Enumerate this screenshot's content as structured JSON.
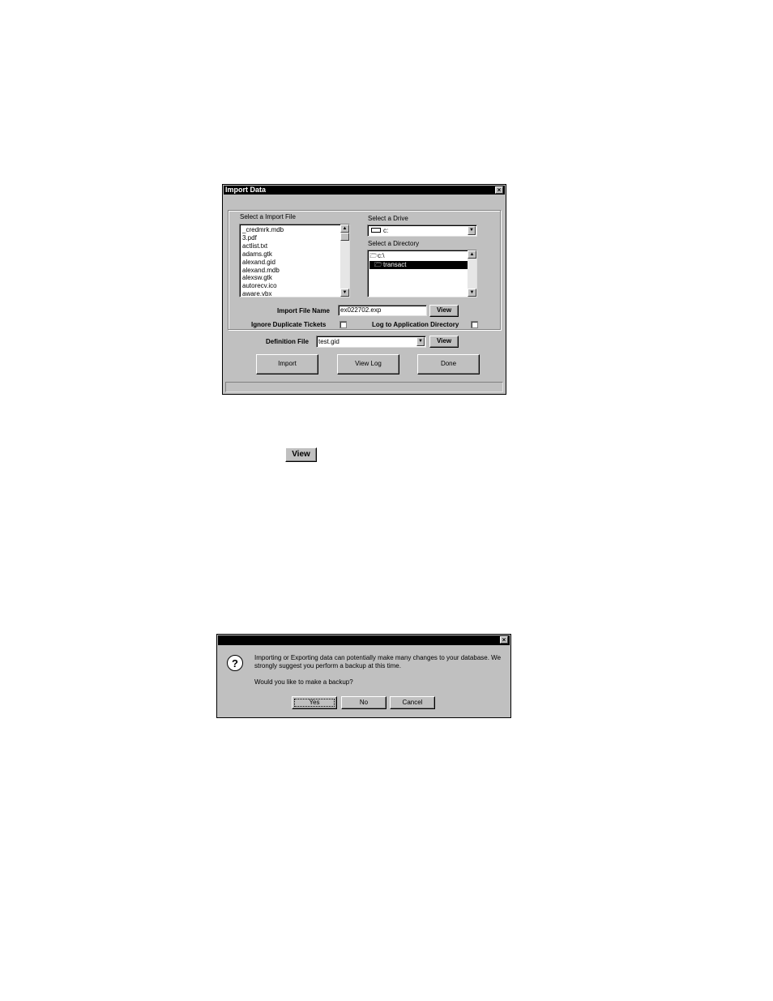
{
  "import_dialog": {
    "title": "Import Data",
    "close_glyph": "×",
    "select_file_label": "Select a Import File",
    "files": [
      "_credmrk.mdb",
      "3.pdf",
      "actlist.txt",
      "adams.gtk",
      "alexand.gid",
      "alexand.mdb",
      "alexsw.gtk",
      "autorecv.ico",
      "aware.vbx"
    ],
    "select_drive_label": "Select a Drive",
    "drive_value": "c:",
    "select_dir_label": "Select a Directory",
    "directories": [
      "c:\\",
      "transact"
    ],
    "import_file_name_label": "Import File Name",
    "import_file_name_value": "ex022702.exp",
    "view_label": "View",
    "ignore_duplicates_label": "Ignore Duplicate Tickets",
    "log_to_app_dir_label": "Log to Application Directory",
    "definition_file_label": "Definition File",
    "definition_file_value": "test.gid",
    "import_btn": "Import",
    "view_log_btn": "View Log",
    "done_btn": "Done"
  },
  "standalone_view_button": "View",
  "backup_dialog": {
    "close_glyph": "×",
    "icon_glyph": "?",
    "message": "Importing or Exporting data can potentially make many changes to your database.  We strongly suggest you perform a backup at this time.",
    "question": "Would you like to make a backup?",
    "yes": "Yes",
    "no": "No",
    "cancel": "Cancel"
  }
}
